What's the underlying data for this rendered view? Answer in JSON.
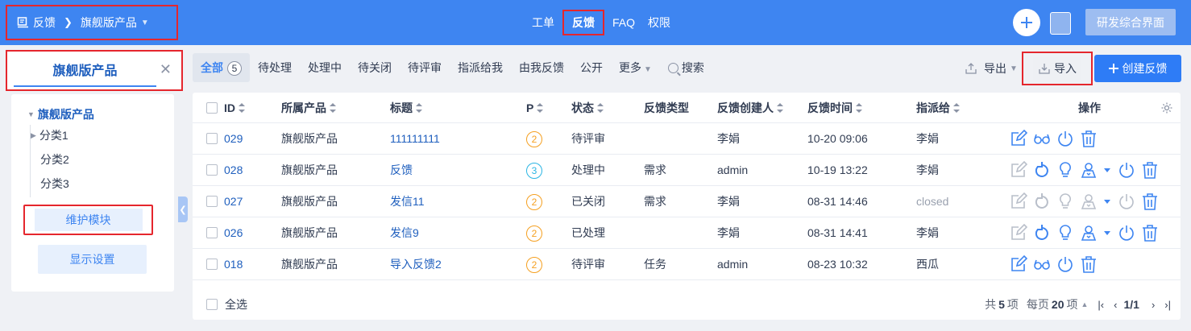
{
  "header": {
    "breadcrumb": {
      "root": "反馈",
      "product": "旗舰版产品"
    },
    "nav": [
      {
        "label": "工单",
        "active": false
      },
      {
        "label": "反馈",
        "active": true
      },
      {
        "label": "FAQ",
        "active": false
      },
      {
        "label": "权限",
        "active": false
      }
    ],
    "right_button": "研发综合界面"
  },
  "sidebar": {
    "title": "旗舰版产品",
    "tree_root": "旗舰版产品",
    "tree_items": [
      "分类1",
      "分类2",
      "分类3"
    ],
    "maintain_button": "维护模块",
    "display_button": "显示设置"
  },
  "filter": {
    "tabs": [
      {
        "label": "全部",
        "count": "5",
        "active": true
      },
      {
        "label": "待处理"
      },
      {
        "label": "处理中"
      },
      {
        "label": "待关闭"
      },
      {
        "label": "待评审"
      },
      {
        "label": "指派给我"
      },
      {
        "label": "由我反馈"
      },
      {
        "label": "公开"
      },
      {
        "label": "更多"
      }
    ],
    "search": "搜索",
    "export": "导出",
    "import": "导入",
    "create": "创建反馈"
  },
  "table": {
    "columns": [
      "ID",
      "所属产品",
      "标题",
      "P",
      "状态",
      "反馈类型",
      "反馈创建人",
      "反馈时间",
      "指派给",
      "操作"
    ],
    "rows": [
      {
        "id": "029",
        "product": "旗舰版产品",
        "title": "111111111",
        "p": "2",
        "status": "待评审",
        "type": "",
        "creator": "李娟",
        "time": "10-20 09:06",
        "assignee": "李娟",
        "actions": "basic"
      },
      {
        "id": "028",
        "product": "旗舰版产品",
        "title": "反馈",
        "p": "3",
        "status": "处理中",
        "type": "需求",
        "creator": "admin",
        "time": "10-19 13:22",
        "assignee": "李娟",
        "actions": "full"
      },
      {
        "id": "027",
        "product": "旗舰版产品",
        "title": "发信11",
        "p": "2",
        "status": "已关闭",
        "type": "需求",
        "creator": "李娟",
        "time": "08-31 14:46",
        "assignee": "closed",
        "actions": "closed"
      },
      {
        "id": "026",
        "product": "旗舰版产品",
        "title": "发信9",
        "p": "2",
        "status": "已处理",
        "type": "",
        "creator": "李娟",
        "time": "08-31 14:41",
        "assignee": "李娟",
        "actions": "full"
      },
      {
        "id": "018",
        "product": "旗舰版产品",
        "title": "导入反馈2",
        "p": "2",
        "status": "待评审",
        "type": "任务",
        "creator": "admin",
        "time": "08-23 10:32",
        "assignee": "西瓜",
        "actions": "basic"
      }
    ],
    "select_all": "全选",
    "pager": {
      "total_prefix": "共",
      "total": "5",
      "total_suffix": "项",
      "per_prefix": "每页",
      "per_page": "20",
      "per_suffix": "项",
      "page": "1/1"
    }
  },
  "colors": {
    "brand": "#3e85f1",
    "highlight": "#e5262d",
    "link": "#1f5fbe",
    "pri2": "#f5a021",
    "pri3": "#2bb5e3"
  }
}
